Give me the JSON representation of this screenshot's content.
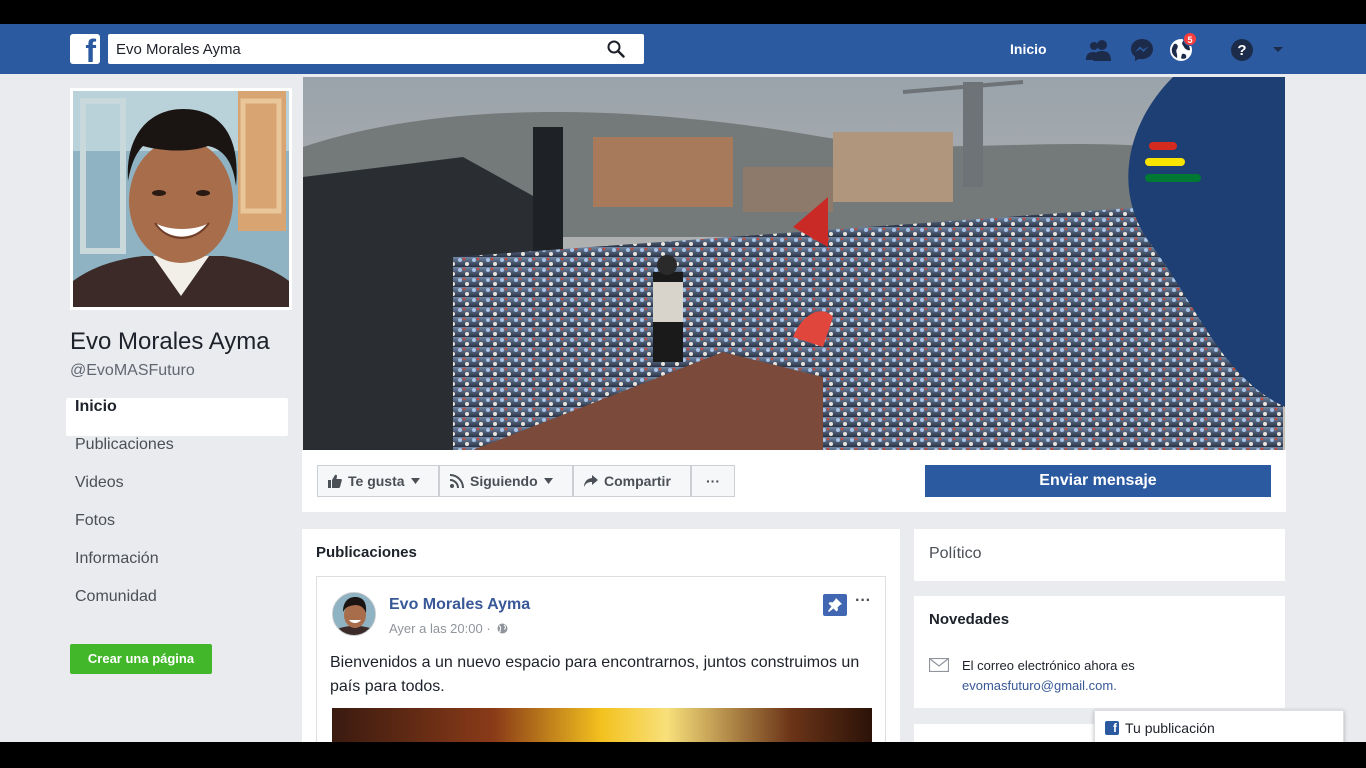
{
  "topbar": {
    "logo_glyph": "f",
    "search_value": "Evo Morales Ayma",
    "nav_home": "Inicio",
    "notifications_count": "5",
    "icons": [
      "friends-icon",
      "messenger-icon",
      "notifications-globe-icon",
      "help-icon",
      "chevron-down-icon"
    ]
  },
  "profile": {
    "name": "Evo Morales Ayma",
    "handle": "@EvoMASFuturo"
  },
  "sidebar": {
    "items": [
      {
        "label": "Inicio",
        "active": true
      },
      {
        "label": "Publicaciones"
      },
      {
        "label": "Videos"
      },
      {
        "label": "Fotos"
      },
      {
        "label": "Información"
      },
      {
        "label": "Comunidad"
      }
    ],
    "create_page": "Crear una página"
  },
  "actions": {
    "like": "Te gusta",
    "following": "Siguiendo",
    "share": "Compartir",
    "more": "···",
    "send_message": "Enviar mensaje"
  },
  "posts": {
    "title": "Publicaciones",
    "post": {
      "author": "Evo Morales Ayma",
      "time": "Ayer a las 20:00 ·",
      "text": "Bienvenidos a un nuevo espacio para encontrarnos, juntos construimos un país para todos.",
      "more": "···"
    }
  },
  "right": {
    "category": "Político",
    "news_title": "Novedades",
    "news_line1": "El correo electrónico ahora es",
    "news_line2": "evomasfuturo@gmail.com.",
    "your_post": "Tu publicación"
  },
  "colors": {
    "brand_blue": "#2b5aa1",
    "create_green": "#42b72a",
    "flag_red": "#d52b1e",
    "flag_yellow": "#f9e300",
    "flag_green": "#007934",
    "cover_panel": "#1e3f73"
  }
}
